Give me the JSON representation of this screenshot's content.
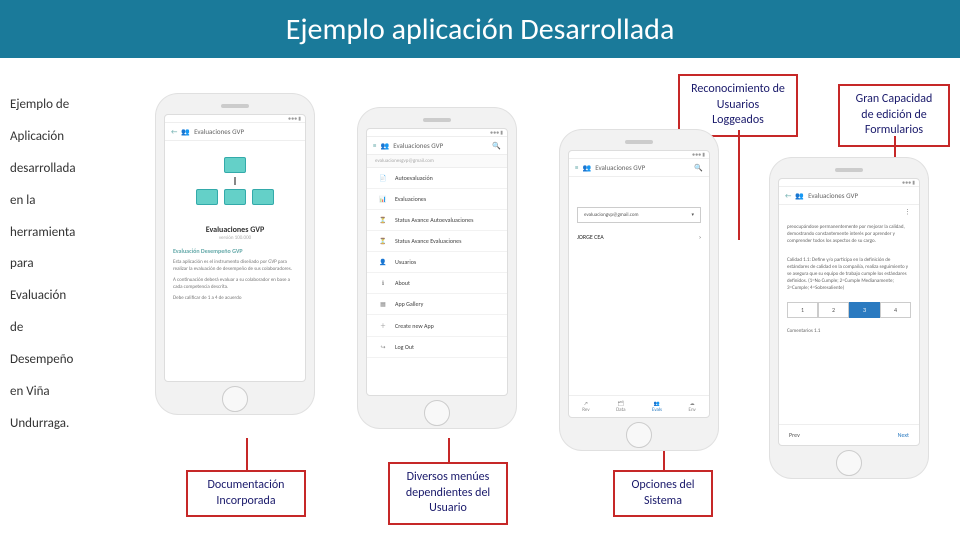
{
  "title": "Ejemplo aplicación Desarrollada",
  "left_desc": [
    "Ejemplo de",
    "Aplicación",
    "desarrollada",
    "en la",
    "herramienta",
    "para",
    "Evaluación",
    "de",
    "Desempeño",
    "en Viña",
    "Undurraga."
  ],
  "callouts": {
    "top1": "Reconocimiento de Usuarios Loggeados",
    "top2": "Gran Capacidad de edición de Formularios",
    "b1": "Documentación Incorporada",
    "b2": "Diversos menúes dependientes del Usuario",
    "b3": "Opciones del Sistema"
  },
  "phone_common": {
    "app_title": "Evaluaciones GVP",
    "search_glyph": "🔍",
    "menu_glyph": "≡",
    "back_glyph": "←",
    "home_glyph": "⌂",
    "people_glyph": "👥"
  },
  "phone1": {
    "big_title": "Evaluaciones GVP",
    "version": "versión 100.000",
    "section": "Evaluación Desempeño GVP",
    "para1": "Esta aplicación es el instrumento diseñado por GVP para realizar la evaluación de desempeño de sus colaboradores.",
    "para2": "A continuación deberá evaluar a su colaborador en base a cada competencia descrita.",
    "para3": "Debe calificar de 1 a 4 de acuerdo"
  },
  "phone2": {
    "subbar": "evaluacionesgvp@gmail.com",
    "menu": [
      "Autoevaluación",
      "Evaluaciones",
      "Status Avance Autoevaluaciones",
      "Status Avance Evaluaciones",
      "Usuarios",
      "About",
      "App Gallery",
      "Create new App",
      "Log Out"
    ],
    "icons": [
      "📄",
      "📊",
      "⏳",
      "⏳",
      "👤",
      "ℹ",
      "▦",
      "＋",
      "↪"
    ]
  },
  "phone3": {
    "email": "evaluaciongvp@gmail.com",
    "user": "JORGE CEA",
    "tabs": [
      "Rev",
      "Data",
      "Evals",
      "Env"
    ],
    "tab_icons": [
      "↗",
      "🗂",
      "👥",
      "☁"
    ]
  },
  "phone4": {
    "body1": "preocupándose permanentemente por mejorar la calidad, demostrando constantemente interés por aprender y comprender todos los aspectos de su cargo.",
    "body2": "Calidad 1.1: Define y/o participa en la definición de estándares de calidad en la compañía, realiza seguimiento y se asegura que su equipo de trabajo cumple los estándares definidos. (1=No Cumple; 2=Cumple Medianamente; 3=Cumple; 4=Sobresaliente)",
    "ratings": [
      "1",
      "2",
      "3",
      "4"
    ],
    "selected": "3",
    "comment_label": "Comentarios 1.1",
    "prev": "Prev",
    "next": "Next"
  }
}
